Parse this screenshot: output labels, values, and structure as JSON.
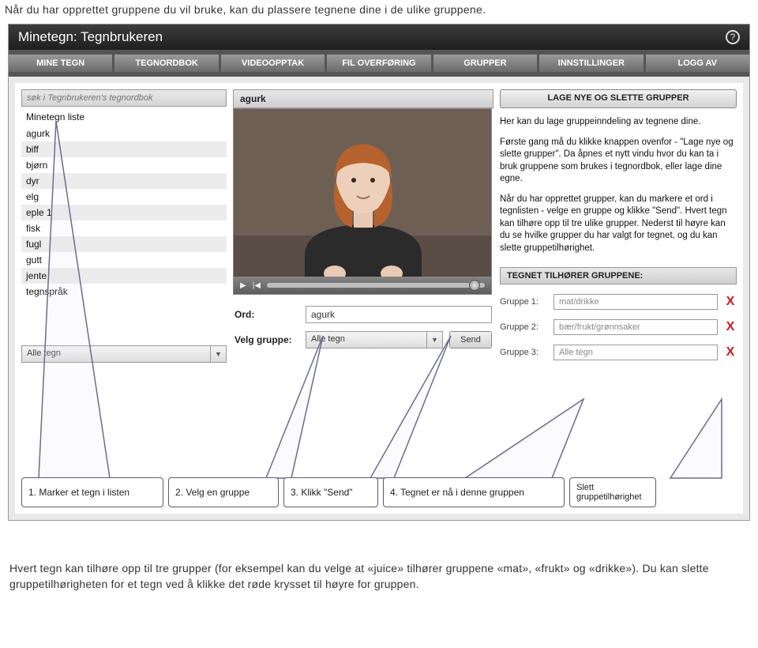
{
  "intro": "Når du har opprettet gruppene du vil bruke, kan du plassere tegnene dine i de ulike gruppene.",
  "app": {
    "title": "Minetegn: Tegnbrukeren",
    "tabs": [
      "MINE TEGN",
      "TEGNORDBOK",
      "VIDEOOPPTAK",
      "FIL OVERFØRING",
      "GRUPPER",
      "INNSTILLINGER",
      "LOGG AV"
    ]
  },
  "search": {
    "placeholder": "søk i Tegnbrukeren's tegnordbok"
  },
  "list": {
    "header": "Minetegn liste",
    "items": [
      "agurk",
      "biff",
      "bjørn",
      "dyr",
      "elg",
      "eple 1",
      "fisk",
      "fugl",
      "gutt",
      "jente",
      "tegnspråk"
    ]
  },
  "language_dropdown": "Alle tegn",
  "video": {
    "title": "agurk"
  },
  "form": {
    "ord_label": "Ord:",
    "ord_value": "agurk",
    "gruppe_label": "Velg gruppe:",
    "gruppe_value": "Alle tegn",
    "send": "Send"
  },
  "right": {
    "make_groups_btn": "LAGE NYE OG SLETTE GRUPPER",
    "help_p1": "Her kan du lage gruppeinndeling av tegnene dine.",
    "help_p2": "Første gang må du klikke knappen ovenfor - \"Lage nye og slette grupper\". Da åpnes et nytt vindu hvor du kan ta i bruk gruppene som brukes i tegnordbok, eller lage dine egne.",
    "help_p3": "Når du har opprettet grupper, kan du markere et ord i tegnlisten - velge en gruppe og klikke \"Send\". Hvert tegn kan tilhøre opp til tre ulike grupper. Nederst til høyre kan du se hvilke grupper du har valgt for tegnet, og du kan slette gruppetilhørighet.",
    "panel_title": "TEGNET TILHØRER GRUPPENE:",
    "rows": [
      {
        "label": "Gruppe 1:",
        "value": "mat/drikke"
      },
      {
        "label": "Gruppe 2:",
        "value": "bær/frukt/grønnsaker"
      },
      {
        "label": "Gruppe 3:",
        "value": "Alle tegn"
      }
    ],
    "x": "X"
  },
  "callouts": [
    "1. Marker et tegn i listen",
    "2. Velg en gruppe",
    "3. Klikk \"Send\"",
    "4. Tegnet er nå i denne gruppen",
    "Slett gruppetilhørighet"
  ],
  "outro": "Hvert tegn kan tilhøre opp til tre grupper (for eksempel kan du velge at «juice» tilhører gruppene «mat», «frukt» og «drikke»). Du kan slette gruppetilhørigheten for et tegn ved å klikke det røde krysset til høyre for gruppen."
}
